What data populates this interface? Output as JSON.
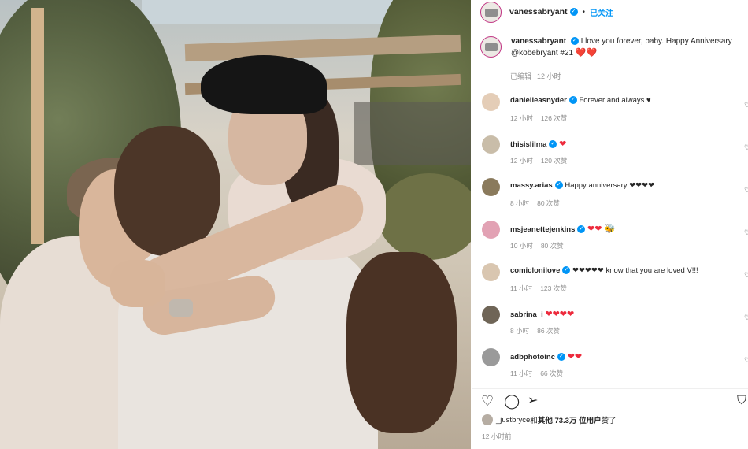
{
  "post": {
    "author": "vanessabryant",
    "header_dot": "•",
    "follow_label": "已关注",
    "caption_text": "I love you forever, baby. Happy Anniversary",
    "caption_mention": "@kobebryant #21",
    "caption_hearts": "❤️❤️",
    "caption_meta_edited": "已编辑",
    "caption_meta_time": "12 小时"
  },
  "comments": [
    {
      "user": "danielleasnyder",
      "text": "Forever and always ♥",
      "time": "12 小时",
      "likes": "126 次赞"
    },
    {
      "user": "thisislilma",
      "text": "❤",
      "time": "12 小时",
      "likes": "120 次赞"
    },
    {
      "user": "massy.arias",
      "text": "Happy anniversary ❤❤❤❤",
      "time": "8 小时",
      "likes": "80 次赞"
    },
    {
      "user": "msjeanettejenkins",
      "text": "❤❤ 🐝",
      "time": "10 小时",
      "likes": "80 次赞"
    },
    {
      "user": "comiclonilove",
      "text": "❤❤❤❤❤ know that you are loved V!!!",
      "time": "11 小时",
      "likes": "123 次赞"
    },
    {
      "user": "sabrina_i",
      "text": "❤❤❤❤",
      "time": "8 小时",
      "likes": "86 次赞"
    },
    {
      "user": "adbphotoinc",
      "text": "❤❤",
      "time": "11 小时",
      "likes": "66 次赞"
    }
  ],
  "likes_line": {
    "user": "_justbryce",
    "middle": " 和 ",
    "others": "其他 73.3万 位用户",
    "suffix": " 赞了"
  },
  "post_time": "12 小时前",
  "icons": [
    "heart-icon",
    "comment-icon",
    "bookmark-icon",
    "verified-badge-icon"
  ],
  "colors": {
    "accent": "#0095f6",
    "heart": "#ed2a3c",
    "muted": "#8e8e8e"
  }
}
